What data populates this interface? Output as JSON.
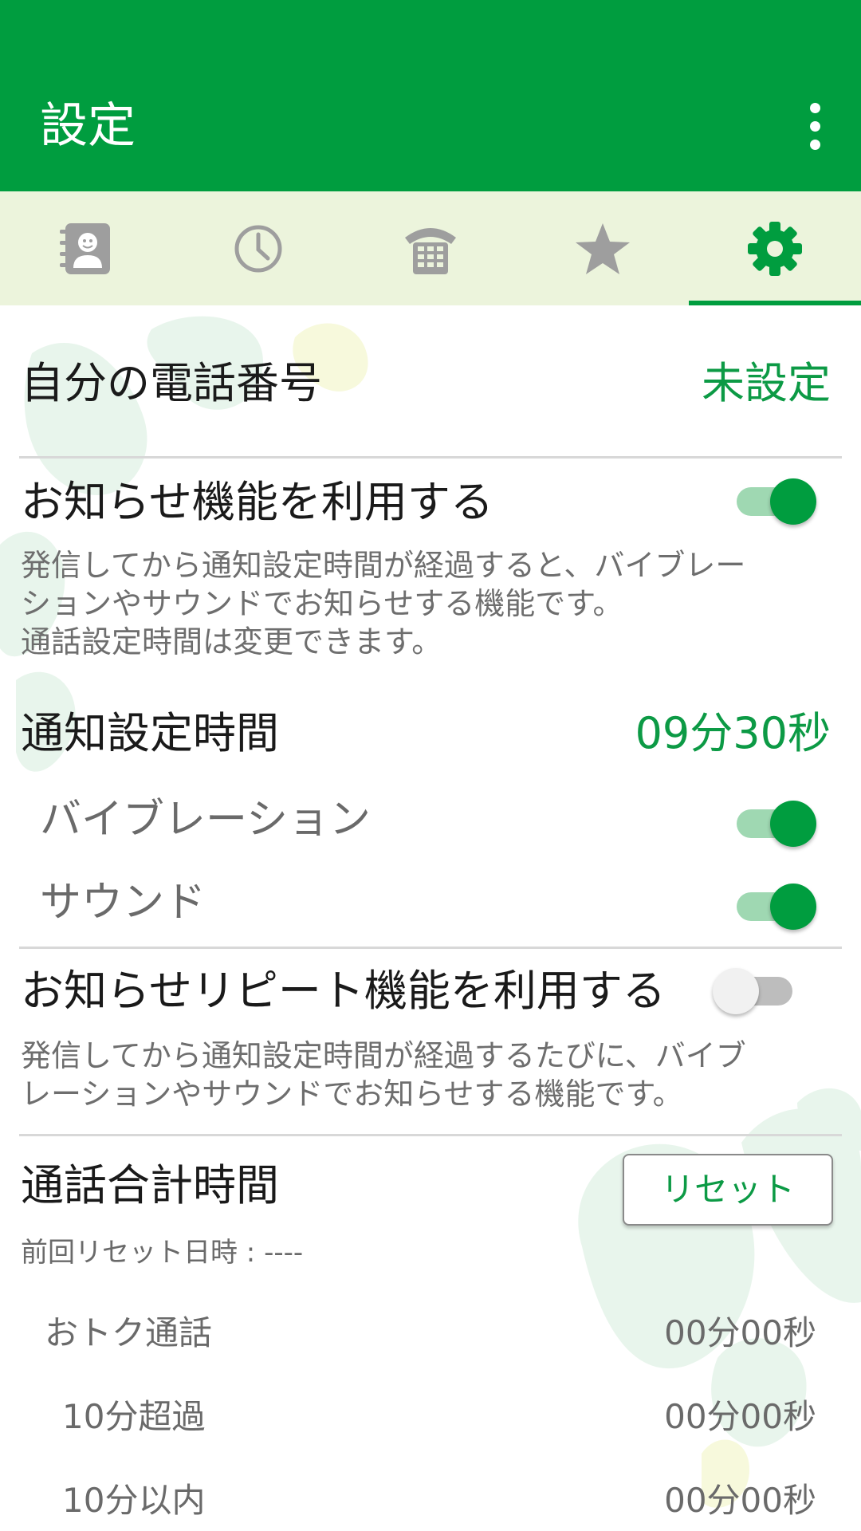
{
  "app_bar": {
    "title": "設定",
    "overflow_icon": "more-vert-icon"
  },
  "tabs": [
    {
      "icon": "contacts-icon",
      "selected": false
    },
    {
      "icon": "history-clock-icon",
      "selected": false
    },
    {
      "icon": "dialpad-phone-icon",
      "selected": false
    },
    {
      "icon": "favorites-star-icon",
      "selected": false
    },
    {
      "icon": "settings-gear-icon",
      "selected": true
    }
  ],
  "colors": {
    "primary": "#009d3f",
    "tab_bar_bg": "#ecf4dc",
    "accent_text": "#0c9a45",
    "icon_inactive": "#9e9e9e"
  },
  "settings": {
    "my_number": {
      "label": "自分の電話番号",
      "value": "未設定"
    },
    "notify": {
      "label": "お知らせ機能を利用する",
      "enabled": true,
      "description_lines": [
        "発信してから通知設定時間が経過すると、バイブレー",
        "ションやサウンドでお知らせする機能です。",
        "通話設定時間は変更できます。"
      ]
    },
    "notify_time": {
      "label": "通知設定時間",
      "value": "09分30秒"
    },
    "vibration": {
      "label": "バイブレーション",
      "enabled": true
    },
    "sound": {
      "label": "サウンド",
      "enabled": true
    },
    "repeat": {
      "label": "お知らせリピート機能を利用する",
      "enabled": false,
      "description_lines": [
        "発信してから通知設定時間が経過するたびに、バイブ",
        "レーションやサウンドでお知らせする機能です。"
      ]
    },
    "total_time": {
      "label": "通話合計時間",
      "reset_label": "リセット",
      "last_reset": "前回リセット日時 : ----",
      "rows": [
        {
          "label": "おトク通話",
          "value": "00分00秒"
        },
        {
          "label": "10分超過",
          "value": "00分00秒"
        },
        {
          "label": "10分以内",
          "value": "00分00秒"
        }
      ]
    }
  }
}
